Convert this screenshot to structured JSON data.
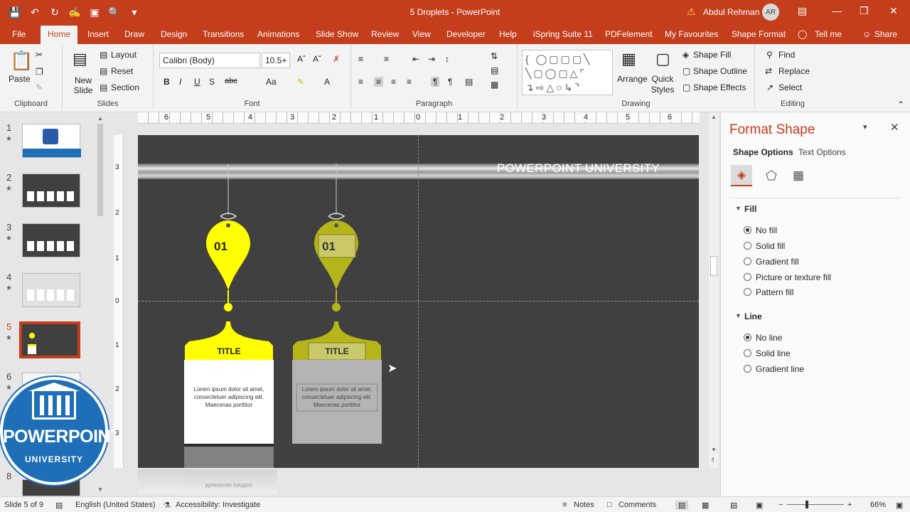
{
  "window": {
    "doc_title": "5 Droplets  -  PowerPoint",
    "user_name": "Abdul Rehman",
    "user_initials": "AR"
  },
  "qat": [
    "save-icon",
    "undo-icon",
    "redo-icon",
    "touch-mode-icon",
    "present-icon",
    "preview-icon",
    "customize-icon"
  ],
  "tabs": [
    "File",
    "Home",
    "Insert",
    "Draw",
    "Design",
    "Transitions",
    "Animations",
    "Slide Show",
    "Review",
    "View",
    "Developer",
    "Help",
    "iSpring Suite 11",
    "PDFelement",
    "My Favourites",
    "Shape Format",
    "Tell me",
    "Share"
  ],
  "active_tab": "Home",
  "ribbon": {
    "clipboard": {
      "label": "Clipboard",
      "paste": "Paste"
    },
    "slides": {
      "label": "Slides",
      "new_slide": "New Slide",
      "layout": "Layout",
      "reset": "Reset",
      "section": "Section"
    },
    "font": {
      "label": "Font",
      "family": "Calibri (Body)",
      "size": "10.5+",
      "bold": "B",
      "italic": "I",
      "underline": "U",
      "strike": "S",
      "spacing": "abc",
      "case": "Aa"
    },
    "paragraph": {
      "label": "Paragraph"
    },
    "drawing": {
      "label": "Drawing",
      "arrange": "Arrange",
      "quick_styles": "Quick Styles",
      "shape_fill": "Shape Fill",
      "shape_outline": "Shape Outline",
      "shape_effects": "Shape Effects"
    },
    "editing": {
      "label": "Editing",
      "find": "Find",
      "replace": "Replace",
      "select": "Select"
    }
  },
  "ruler_h": [
    "6",
    "5",
    "4",
    "3",
    "2",
    "1",
    "0",
    "1",
    "2",
    "3",
    "4",
    "5",
    "6"
  ],
  "ruler_v": [
    "3",
    "2",
    "1",
    "0",
    "1",
    "2",
    "3"
  ],
  "thumbnails": [
    {
      "num": "1",
      "star": "★"
    },
    {
      "num": "2",
      "star": "★"
    },
    {
      "num": "3",
      "star": "★"
    },
    {
      "num": "4",
      "star": "★"
    },
    {
      "num": "5",
      "star": "★",
      "selected": true
    },
    {
      "num": "6",
      "star": "★"
    },
    {
      "num": "8",
      "star": ""
    }
  ],
  "slide": {
    "banner_text": "POWERPOINT UNIVERSITY",
    "drop1_number": "01",
    "drop2_number": "01",
    "card1_title": "TITLE",
    "card2_title": "TITLE",
    "card_text_l1": "Lorem ipsum dolor sit amet,",
    "card_text_l2": "consectetuer adipiscing elit.",
    "card_text_l3": "Maecenas porttitor",
    "reflection_text": "Maecenas porttitor"
  },
  "logo": {
    "top_text": "POWERPOINT",
    "bottom_text": "UNIVERSITY"
  },
  "format_pane": {
    "title": "Format Shape",
    "tab_shape": "Shape Options",
    "tab_text": "Text Options",
    "fill_header": "Fill",
    "fill_options": [
      "No fill",
      "Solid fill",
      "Gradient fill",
      "Picture or texture fill",
      "Pattern fill"
    ],
    "fill_selected": "No fill",
    "line_header": "Line",
    "line_options": [
      "No line",
      "Solid line",
      "Gradient line"
    ],
    "line_selected": "No line"
  },
  "status": {
    "slide_info": "Slide 5 of 9",
    "language": "English (United States)",
    "accessibility": "Accessibility: Investigate",
    "notes": "Notes",
    "comments": "Comments",
    "zoom": "66%"
  },
  "colors": {
    "brand": "#c43e1c",
    "slide_bg": "#404040",
    "yellow": "#ffff00",
    "olive": "#b5b51a"
  }
}
